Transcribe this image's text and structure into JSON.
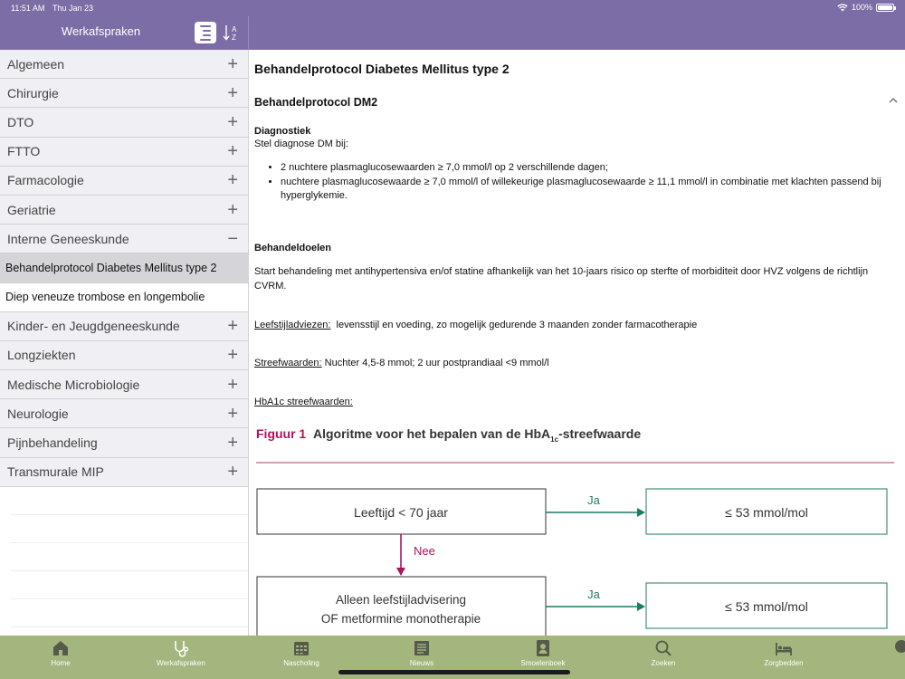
{
  "status": {
    "time": "11:51 AM",
    "date": "Thu Jan 23",
    "battery": "100%"
  },
  "header": {
    "title": "Werkafspraken",
    "list_icon": "list-view-icon",
    "sort_icon": "sort-az-icon"
  },
  "sidebar": {
    "items": [
      {
        "label": "Algemeen",
        "state": "+"
      },
      {
        "label": "Chirurgie",
        "state": "+"
      },
      {
        "label": "DTO",
        "state": "+"
      },
      {
        "label": "FTTO",
        "state": "+"
      },
      {
        "label": "Farmacologie",
        "state": "+"
      },
      {
        "label": "Geriatrie",
        "state": "+"
      },
      {
        "label": "Interne Geneeskunde",
        "state": "−"
      },
      {
        "label": "Kinder- en Jeugdgeneeskunde",
        "state": "+"
      },
      {
        "label": "Longziekten",
        "state": "+"
      },
      {
        "label": "Medische Microbiologie",
        "state": "+"
      },
      {
        "label": "Neurologie",
        "state": "+"
      },
      {
        "label": "Pijnbehandeling",
        "state": "+"
      },
      {
        "label": "Transmurale MIP",
        "state": "+"
      }
    ],
    "subitems": [
      {
        "label": "Behandelprotocol Diabetes Mellitus type 2",
        "active": true
      },
      {
        "label": "Diep veneuze trombose en longembolie",
        "active": false
      }
    ]
  },
  "content": {
    "title": "Behandelprotocol Diabetes Mellitus type 2",
    "section_title": "Behandelprotocol DM2",
    "diagnostiek_heading": "Diagnostiek",
    "diagnostiek_intro": "Stel diagnose DM bij:",
    "bullets": [
      "2 nuchtere plasmaglucosewaarden ≥ 7,0 mmol/l op 2 verschillende dagen;",
      "nuchtere plasmaglucosewaarde ≥ 7,0 mmol/l of willekeurige plasmaglucosewaarde ≥ 11,1 mmol/l in combinatie met klachten passend bij hyperglykemie."
    ],
    "behandeldoelen_heading": "Behandeldoelen",
    "behandeldoelen_text": "Start behandeling met antihypertensiva en/of statine afhankelijk van het 10-jaars risico op sterfte of morbiditeit door HVZ volgens de richtlijn CVRM.",
    "leefstijl_label": "Leefstijladviezen:",
    "leefstijl_text": "levensstijl en voeding, zo mogelijk gedurende 3 maanden zonder farmacotherapie",
    "streef_label": "Streefwaarden:",
    "streef_text": "Nuchter 4,5-8 mmol; 2 uur postprandiaal <9 mmol/l",
    "hba1c_label": "HbA1c streefwaarden:",
    "figure": {
      "label": "Figuur 1",
      "title_pre": "Algoritme voor het bepalen van de HbA",
      "title_sub": "1c",
      "title_post": "-streefwaarde",
      "box1": "Leeftijd < 70 jaar",
      "yes1": "Ja",
      "result1": "≤ 53 mmol/mol",
      "no1": "Nee",
      "box2_line1": "Alleen leefstijladvisering",
      "box2_line2": "OF metformine monotherapie",
      "yes2": "Ja",
      "result2": "≤ 53 mmol/mol"
    }
  },
  "tabbar": {
    "items": [
      {
        "label": "Home",
        "icon": "home-icon"
      },
      {
        "label": "Werkafspraken",
        "icon": "stethoscope-icon"
      },
      {
        "label": "Nascholing",
        "icon": "calendar-icon"
      },
      {
        "label": "Nieuws",
        "icon": "newspaper-icon"
      },
      {
        "label": "Smoelenboek",
        "icon": "contact-book-icon"
      },
      {
        "label": "Zoeken",
        "icon": "search-icon"
      },
      {
        "label": "Zorgbedden",
        "icon": "bed-icon"
      }
    ]
  },
  "colors": {
    "header": "#7d6da6",
    "tabbar": "#a2b67d",
    "figure_accent": "#b0135b",
    "figure_green": "#1f7a63"
  }
}
